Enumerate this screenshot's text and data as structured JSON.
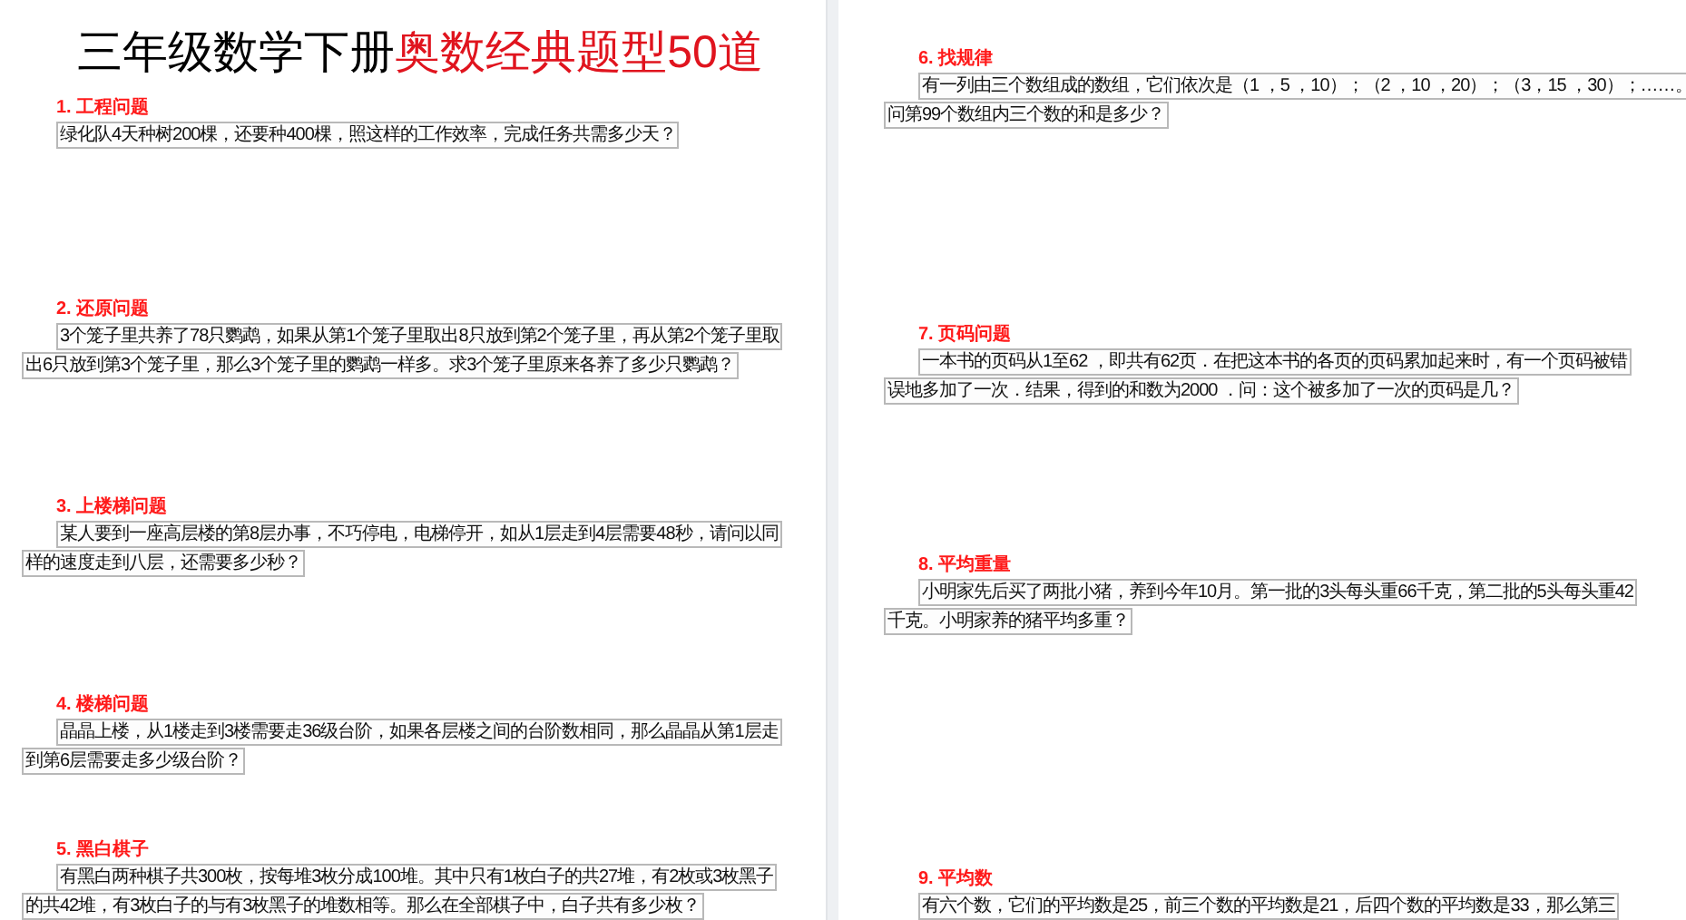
{
  "title": {
    "segments": [
      {
        "text": "三年级数学下册",
        "color": "#000000"
      },
      {
        "text": "奥数经典题型50道",
        "color": "#e0141e"
      }
    ]
  },
  "pages": [
    {
      "questions": [
        {
          "heading": "1. 工程问题",
          "lines": [
            "绿化队4天种树200棵，还要种400棵，照这样的工作效率，完成任务共需多少天？"
          ]
        },
        {
          "heading": "2. 还原问题",
          "lines": [
            "3个笼子里共养了78只鹦鹉，如果从第1个笼子里取出8只放到第2个笼子里，再从第2个笼子里取",
            "出6只放到第3个笼子里，那么3个笼子里的鹦鹉一样多。求3个笼子里原来各养了多少只鹦鹉？"
          ]
        },
        {
          "heading": "3. 上楼梯问题",
          "lines": [
            "某人要到一座高层楼的第8层办事，不巧停电，电梯停开，如从1层走到4层需要48秒，请问以同",
            "样的速度走到八层，还需要多少秒？"
          ]
        },
        {
          "heading": "4. 楼梯问题",
          "lines": [
            "晶晶上楼，从1楼走到3楼需要走36级台阶，如果各层楼之间的台阶数相同，那么晶晶从第1层走",
            "到第6层需要走多少级台阶？"
          ]
        },
        {
          "heading": "5. 黑白棋子",
          "lines": [
            "有黑白两种棋子共300枚，按每堆3枚分成100堆。其中只有1枚白子的共27堆，有2枚或3枚黑子",
            "的共42堆，有3枚白子的与有3枚黑子的堆数相等。那么在全部棋子中，白子共有多少枚？"
          ]
        }
      ]
    },
    {
      "questions": [
        {
          "heading": "6. 找规律",
          "lines": [
            "有一列由三个数组成的数组，它们依次是（1 ，5 ，10）；（2 ，10 ，20）；（3，15 ，30）；……。",
            "问第99个数组内三个数的和是多少？"
          ]
        },
        {
          "heading": "7. 页码问题",
          "lines": [
            "一本书的页码从1至62 ，即共有62页．在把这本书的各页的页码累加起来时，有一个页码被错",
            "误地多加了一次．结果，得到的和数为2000 ．问：这个被多加了一次的页码是几？"
          ]
        },
        {
          "heading": "8. 平均重量",
          "lines": [
            "小明家先后买了两批小猪，养到今年10月。第一批的3头每头重66千克，第二批的5头每头重42",
            "千克。小明家养的猪平均多重？"
          ]
        },
        {
          "heading": "9. 平均数",
          "lines": [
            "有六个数，它们的平均数是25，前三个数的平均数是21，后四个数的平均数是33，那么第三"
          ]
        }
      ]
    }
  ]
}
